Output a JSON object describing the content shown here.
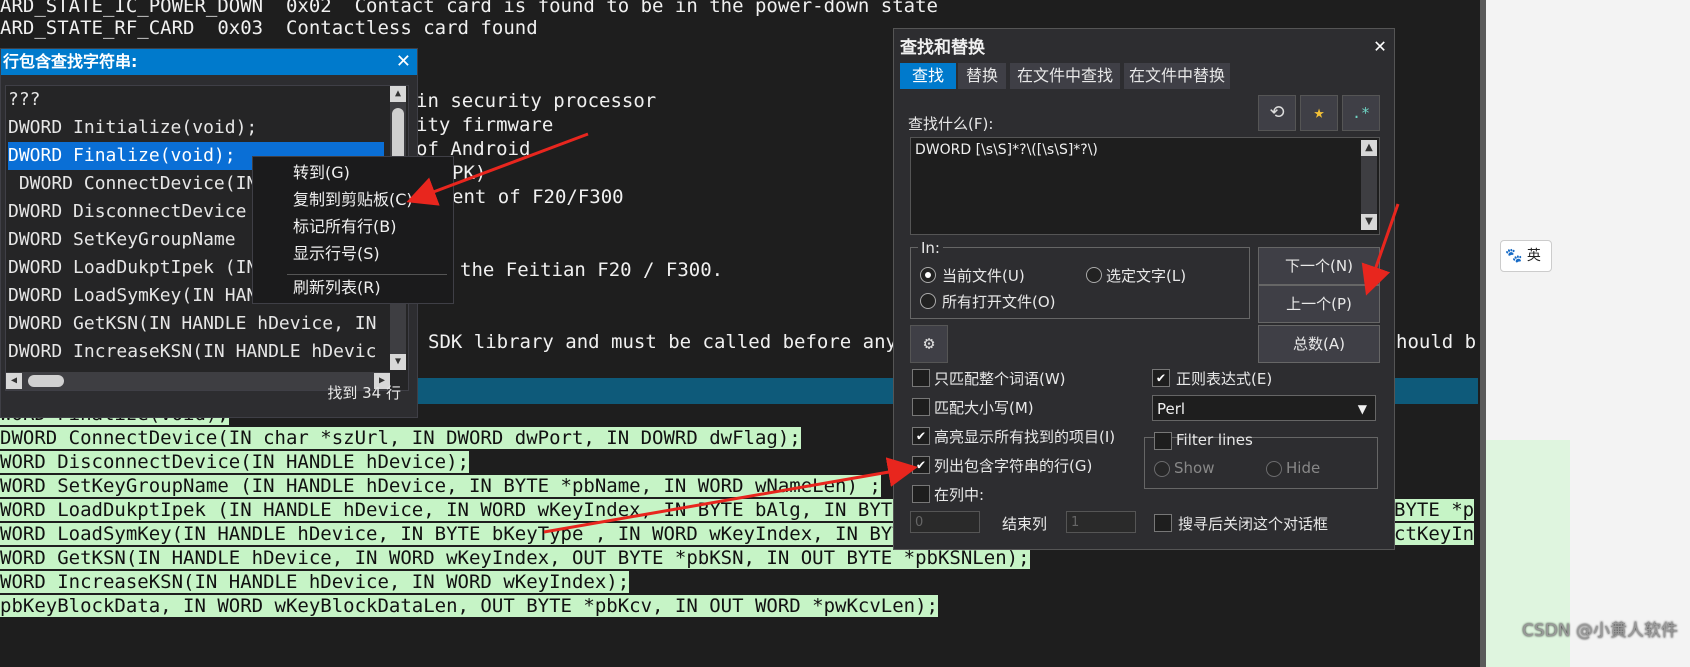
{
  "editor": {
    "top_lines": [
      "ARD_STATE_IC_POWER_DOWN  0x02  Contact card is found to be in the power-down state",
      "ARD_STATE_RF_CARD  0x03  Contactless card found"
    ],
    "mid_lines": [
      "in security processor",
      "ity firmware",
      "of Android",
      "PK)",
      "ent of F20/F300",
      "the Feitian F20 / F300.",
      "SDK library and must be called before any",
      "hould b"
    ],
    "result_lines": [
      "WORD Finalize(void);",
      "DWORD ConnectDevice(IN char *szUrl, IN DWORD dwPort, IN DOWRD dwFlag);",
      "WORD DisconnectDevice(IN HANDLE hDevice);",
      "WORD SetKeyGroupName (IN HANDLE hDevice, IN BYTE *pbName, IN WORD wNameLen) ;",
      "WORD LoadDukptIpek (IN HANDLE hDevice, IN WORD wKeyIndex, IN BYTE bAlg, IN BYTE b",
      "WORD LoadSymKey(IN HANDLE hDevice, IN BYTE bKeyType , IN WORD wKeyIndex, IN BYTE",
      "WORD GetKSN(IN HANDLE hDevice, IN WORD wKeyIndex, OUT BYTE *pbKSN, IN OUT BYTE *pbKSNLen);",
      "WORD IncreaseKSN(IN HANDLE hDevice, IN WORD wKeyIndex);",
      "pbKeyBlockData, IN WORD wKeyBlockDataLen, OUT BYTE *pbKcv, IN OUT WORD *pwKcvLen);"
    ],
    "right_tails": [
      "BYTE *p",
      "ctKeyIn"
    ]
  },
  "lines_panel": {
    "title": "行包含查找字符串:",
    "items": [
      "???",
      "DWORD Initialize(void);",
      "DWORD Finalize(void);",
      " DWORD ConnectDevice(IN",
      "DWORD DisconnectDevice",
      "DWORD SetKeyGroupName",
      "DWORD LoadDukptIpek (IN",
      "DWORD LoadSymKey(IN HAN",
      "DWORD GetKSN(IN HANDLE hDevice, IN",
      "DWORD IncreaseKSN(IN HANDLE hDevic"
    ],
    "selected_index": 2,
    "count_label": "找到 34 行"
  },
  "context_menu": {
    "items": [
      "转到(G)",
      "复制到剪贴板(C)",
      "标记所有行(B)",
      "显示行号(S)",
      "刷新列表(R)"
    ]
  },
  "dialog": {
    "title": "查找和替换",
    "tabs": [
      "查找",
      "替换",
      "在文件中查找",
      "在文件中替换"
    ],
    "active_tab": 0,
    "find_label": "查找什么(F):",
    "find_value": "DWORD [\\s\\S]*?\\([\\s\\S]*?\\)",
    "in_label": "In:",
    "radios": {
      "current_file": "当前文件(U)",
      "selected_text": "选定文字(L)",
      "all_open_files": "所有打开文件(O)"
    },
    "buttons": {
      "next": "下一个(N)",
      "prev": "上一个(P)",
      "count": "总数(A)"
    },
    "options": {
      "whole_word": "只匹配整个词语(W)",
      "match_case": "匹配大小写(M)",
      "highlight_all": "高亮显示所有找到的项目(I)",
      "list_lines": "列出包含字符串的行(G)",
      "in_column": "在列中:",
      "regex": "正则表达式(E)",
      "close_after": "搜寻后关闭这个对话框"
    },
    "regex_engine": "Perl",
    "filter_lines": {
      "label": "Filter lines",
      "show": "Show",
      "hide": "Hide"
    },
    "column_start": "0",
    "end_column_label": "结束列",
    "column_end": "1"
  },
  "ime_label": "英",
  "watermark": "CSDN @小黄人软件",
  "colors": {
    "accent": "#007acc",
    "highlight": "#c6f4c6",
    "annotation": "#e8261e"
  }
}
